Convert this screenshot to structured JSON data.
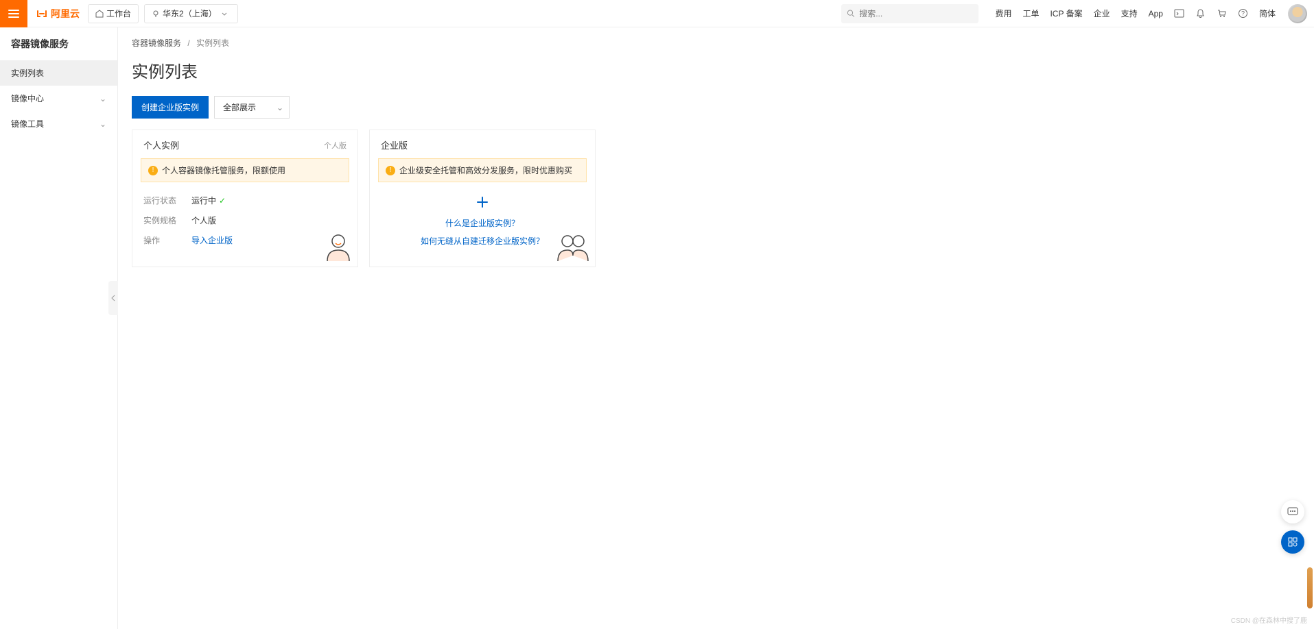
{
  "header": {
    "logo_text": "阿里云",
    "workbench": "工作台",
    "region": "华东2（上海）",
    "search_placeholder": "搜索...",
    "links": {
      "fee": "费用",
      "ticket": "工单",
      "icp": "ICP 备案",
      "enterprise": "企业",
      "support": "支持",
      "app": "App",
      "lang": "简体"
    }
  },
  "sidebar": {
    "title": "容器镜像服务",
    "items": [
      {
        "label": "实例列表",
        "active": true,
        "expandable": false
      },
      {
        "label": "镜像中心",
        "active": false,
        "expandable": true
      },
      {
        "label": "镜像工具",
        "active": false,
        "expandable": true
      }
    ]
  },
  "breadcrumb": {
    "root": "容器镜像服务",
    "current": "实例列表"
  },
  "page": {
    "title": "实例列表",
    "create_btn": "创建企业版实例",
    "filter_value": "全部展示"
  },
  "personal_card": {
    "title": "个人实例",
    "tag": "个人版",
    "banner": "个人容器镜像托管服务，限额使用",
    "rows": {
      "status_label": "运行状态",
      "status_value": "运行中",
      "spec_label": "实例规格",
      "spec_value": "个人版",
      "action_label": "操作",
      "action_link": "导入企业版"
    }
  },
  "enterprise_card": {
    "title": "企业版",
    "banner": "企业级安全托管和高效分发服务，限时优惠购买",
    "link1": "什么是企业版实例？",
    "link2": "如何无缝从自建迁移企业版实例？"
  },
  "watermark": "CSDN @在森林中搜了鹿"
}
